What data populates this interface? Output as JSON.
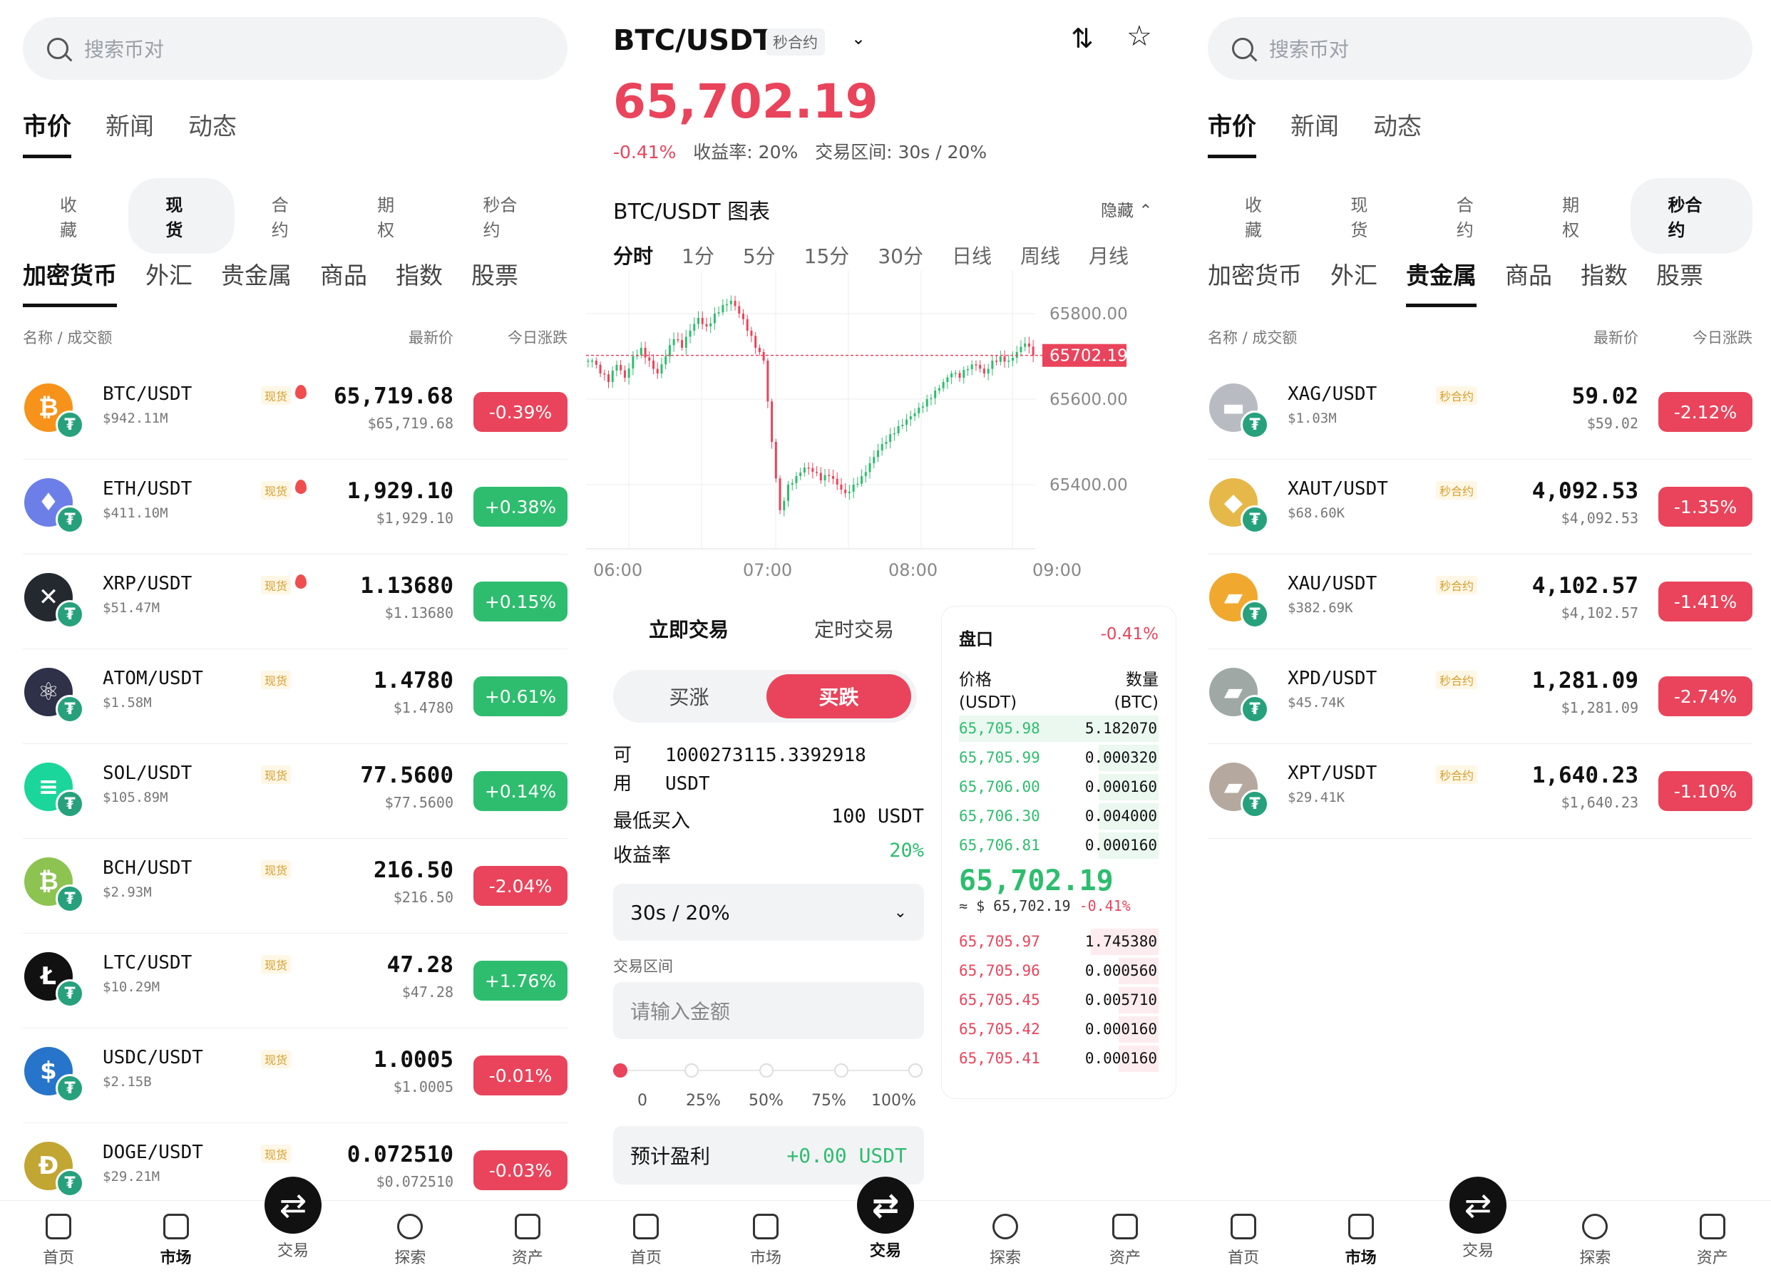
{
  "left": {
    "search_placeholder": "搜索币对",
    "top_tabs": [
      "市价",
      "新闻",
      "动态"
    ],
    "pills": [
      "收藏",
      "现货",
      "合约",
      "期权",
      "秒合约"
    ],
    "cats": [
      "加密货币",
      "外汇",
      "贵金属",
      "商品",
      "指数",
      "股票"
    ],
    "col_name": "名称 / 成交额",
    "col_price": "最新价",
    "col_change": "今日涨跌",
    "rows": [
      {
        "symbol": "BTC/USDT",
        "volume": "$942.11M",
        "tag": "现货",
        "price": "65,719.68",
        "sub": "$65,719.68",
        "change": "-0.39%",
        "dir": "dn",
        "icon": "₿",
        "color": "#f7931a"
      },
      {
        "symbol": "ETH/USDT",
        "volume": "$411.10M",
        "tag": "现货",
        "price": "1,929.10",
        "sub": "$1,929.10",
        "change": "+0.38%",
        "dir": "up",
        "icon": "♦",
        "color": "#6c7fe8"
      },
      {
        "symbol": "XRP/USDT",
        "volume": "$51.47M",
        "tag": "现货",
        "price": "1.13680",
        "sub": "$1.13680",
        "change": "+0.15%",
        "dir": "up",
        "icon": "✕",
        "color": "#23292f"
      },
      {
        "symbol": "ATOM/USDT",
        "volume": "$1.58M",
        "tag": "现货",
        "price": "1.4780",
        "sub": "$1.4780",
        "change": "+0.61%",
        "dir": "up",
        "icon": "⚛",
        "color": "#2e3148"
      },
      {
        "symbol": "SOL/USDT",
        "volume": "$105.89M",
        "tag": "现货",
        "price": "77.5600",
        "sub": "$77.5600",
        "change": "+0.14%",
        "dir": "up",
        "icon": "≡",
        "color": "#1bd69a"
      },
      {
        "symbol": "BCH/USDT",
        "volume": "$2.93M",
        "tag": "现货",
        "price": "216.50",
        "sub": "$216.50",
        "change": "-2.04%",
        "dir": "dn",
        "icon": "₿",
        "color": "#8dc351"
      },
      {
        "symbol": "LTC/USDT",
        "volume": "$10.29M",
        "tag": "现货",
        "price": "47.28",
        "sub": "$47.28",
        "change": "+1.76%",
        "dir": "up",
        "icon": "Ł",
        "color": "#111111"
      },
      {
        "symbol": "USDC/USDT",
        "volume": "$2.15B",
        "tag": "现货",
        "price": "1.0005",
        "sub": "$1.0005",
        "change": "-0.01%",
        "dir": "dn",
        "icon": "$",
        "color": "#2775ca"
      },
      {
        "symbol": "DOGE/USDT",
        "volume": "$29.21M",
        "tag": "现货",
        "price": "0.072510",
        "sub": "$0.072510",
        "change": "-0.03%",
        "dir": "dn",
        "icon": "Ð",
        "color": "#c2a633"
      }
    ]
  },
  "middle": {
    "pair": "BTC/USDT",
    "pair_badge": "秒合约",
    "price": "65,702.19",
    "change": "-0.41%",
    "stat_rest": "收益率: 20%   交易区间: 30s / 20%",
    "chart_title": "BTC/USDT 图表",
    "hide": "隐藏",
    "intervals": [
      "分时",
      "1分",
      "5分",
      "15分",
      "30分",
      "日线",
      "周线",
      "月线"
    ],
    "trade_tabs": [
      "立即交易",
      "定时交易"
    ],
    "seg_up": "买涨",
    "seg_down": "买跌",
    "avail_label1": "可",
    "avail_label2": "用",
    "avail_value": "1000273115.3392918",
    "avail_unit": "USDT",
    "min_buy_label": "最低买入",
    "min_buy_value": "100 USDT",
    "yield_label": "收益率",
    "yield_value": "20%",
    "select_value": "30s / 20%",
    "range_label": "交易区间",
    "amount_placeholder": "请输入金额",
    "pcts": [
      "0",
      "25%",
      "50%",
      "75%",
      "100%"
    ],
    "profit_label": "预计盈利",
    "profit_value": "+0.00 USDT",
    "book": {
      "title": "盘口",
      "change": "-0.41%",
      "price_hdr1": "价格",
      "price_hdr2": "(USDT)",
      "qty_hdr1": "数量",
      "qty_hdr2": "(BTC)",
      "bids": [
        [
          "65,705.98",
          "5.182070"
        ],
        [
          "65,705.99",
          "0.000320"
        ],
        [
          "65,706.00",
          "0.000160"
        ],
        [
          "65,706.30",
          "0.004000"
        ],
        [
          "65,706.81",
          "0.000160"
        ]
      ],
      "mid": "65,702.19",
      "mid_sub": "≈ $ 65,702.19",
      "mid_chg": "-0.41%",
      "asks": [
        [
          "65,705.97",
          "1.745380"
        ],
        [
          "65,705.96",
          "0.000560"
        ],
        [
          "65,705.45",
          "0.005710"
        ],
        [
          "65,705.42",
          "0.000160"
        ],
        [
          "65,705.41",
          "0.000160"
        ]
      ]
    }
  },
  "right": {
    "search_placeholder": "搜索币对",
    "top_tabs": [
      "市价",
      "新闻",
      "动态"
    ],
    "pills": [
      "收藏",
      "现货",
      "合约",
      "期权",
      "秒合约"
    ],
    "cats": [
      "加密货币",
      "外汇",
      "贵金属",
      "商品",
      "指数",
      "股票"
    ],
    "col_name": "名称 / 成交额",
    "col_price": "最新价",
    "col_change": "今日涨跌",
    "rows": [
      {
        "symbol": "XAG/USDT",
        "volume": "$1.03M",
        "tag": "秒合约",
        "price": "59.02",
        "sub": "$59.02",
        "change": "-2.12%",
        "dir": "dn",
        "icon": "▬",
        "color": "#b8bcc2"
      },
      {
        "symbol": "XAUT/USDT",
        "volume": "$68.60K",
        "tag": "秒合约",
        "price": "4,092.53",
        "sub": "$4,092.53",
        "change": "-1.35%",
        "dir": "dn",
        "icon": "◆",
        "color": "#e6b84a"
      },
      {
        "symbol": "XAU/USDT",
        "volume": "$382.69K",
        "tag": "秒合约",
        "price": "4,102.57",
        "sub": "$4,102.57",
        "change": "-1.41%",
        "dir": "dn",
        "icon": "▰",
        "color": "#f0a92e"
      },
      {
        "symbol": "XPD/USDT",
        "volume": "$45.74K",
        "tag": "秒合约",
        "price": "1,281.09",
        "sub": "$1,281.09",
        "change": "-2.74%",
        "dir": "dn",
        "icon": "▰",
        "color": "#9fa8a4"
      },
      {
        "symbol": "XPT/USDT",
        "volume": "$29.41K",
        "tag": "秒合约",
        "price": "1,640.23",
        "sub": "$1,640.23",
        "change": "-1.10%",
        "dir": "dn",
        "icon": "▰",
        "color": "#b5a99f"
      }
    ]
  },
  "nav": [
    "首页",
    "市场",
    "交易",
    "探索",
    "资产"
  ],
  "chart_data": {
    "type": "candlestick",
    "title": "BTC/USDT 图表",
    "x_ticks": [
      "06:00",
      "07:00",
      "08:00",
      "09:00"
    ],
    "y_ticks": [
      "65800.00",
      "65600.00",
      "65400.00"
    ],
    "current_price_label": "65702.19",
    "ylim": [
      65250,
      65900
    ],
    "close_series": [
      65690,
      65660,
      65640,
      65680,
      65650,
      65700,
      65720,
      65690,
      65660,
      65700,
      65740,
      65720,
      65760,
      65790,
      65770,
      65800,
      65820,
      65830,
      65800,
      65760,
      65720,
      65690,
      65500,
      65340,
      65400,
      65420,
      65440,
      65430,
      65410,
      65420,
      65400,
      65380,
      65400,
      65420,
      65450,
      65480,
      65500,
      65520,
      65540,
      65560,
      65580,
      65600,
      65620,
      65640,
      65660,
      65650,
      65670,
      65680,
      65660,
      65690,
      65700,
      65690,
      65710,
      65730,
      65702
    ]
  }
}
